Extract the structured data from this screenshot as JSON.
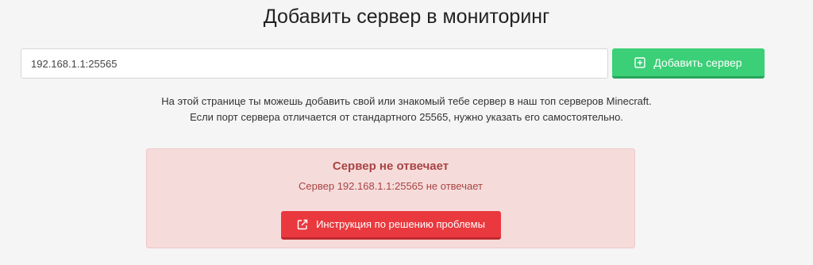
{
  "header": {
    "title": "Добавить сервер в мониторинг"
  },
  "form": {
    "address_value": "192.168.1.1:25565",
    "add_button_label": "Добавить сервер",
    "add_button_icon": "plus-square-icon",
    "add_button_color": "#3bcf77"
  },
  "description": {
    "line1": "На этой странице ты можешь добавить свой или знакомый тебе сервер в наш топ серверов Minecraft.",
    "line2": "Если порт сервера отличается от стандартного 25565, нужно указать его самостоятельно."
  },
  "error": {
    "title": "Сервер не отвечает",
    "message": "Сервер 192.168.1.1:25565 не отвечает",
    "help_button_label": "Инструкция по решению проблемы",
    "help_button_icon": "external-link-icon",
    "background_color": "#f5dcdb",
    "text_color": "#a94442",
    "button_color": "#e9393e"
  }
}
